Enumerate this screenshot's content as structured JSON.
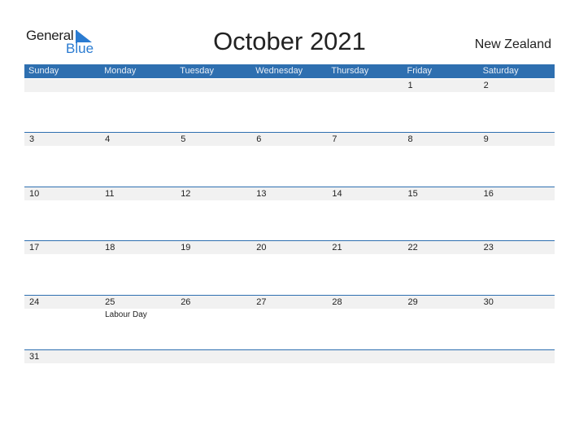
{
  "logo": {
    "line1": "General",
    "line2": "Blue"
  },
  "title": "October 2021",
  "country": "New Zealand",
  "colors": {
    "header_bg": "#2e6fb0",
    "logo_blue": "#2a7bd1",
    "date_strip": "#f1f1f1"
  },
  "weekdays": [
    "Sunday",
    "Monday",
    "Tuesday",
    "Wednesday",
    "Thursday",
    "Friday",
    "Saturday"
  ],
  "weeks": [
    [
      {
        "d": ""
      },
      {
        "d": ""
      },
      {
        "d": ""
      },
      {
        "d": ""
      },
      {
        "d": ""
      },
      {
        "d": "1"
      },
      {
        "d": "2"
      }
    ],
    [
      {
        "d": "3"
      },
      {
        "d": "4"
      },
      {
        "d": "5"
      },
      {
        "d": "6"
      },
      {
        "d": "7"
      },
      {
        "d": "8"
      },
      {
        "d": "9"
      }
    ],
    [
      {
        "d": "10"
      },
      {
        "d": "11"
      },
      {
        "d": "12"
      },
      {
        "d": "13"
      },
      {
        "d": "14"
      },
      {
        "d": "15"
      },
      {
        "d": "16"
      }
    ],
    [
      {
        "d": "17"
      },
      {
        "d": "18"
      },
      {
        "d": "19"
      },
      {
        "d": "20"
      },
      {
        "d": "21"
      },
      {
        "d": "22"
      },
      {
        "d": "23"
      }
    ],
    [
      {
        "d": "24"
      },
      {
        "d": "25",
        "event": "Labour Day"
      },
      {
        "d": "26"
      },
      {
        "d": "27"
      },
      {
        "d": "28"
      },
      {
        "d": "29"
      },
      {
        "d": "30"
      }
    ],
    [
      {
        "d": "31"
      },
      {
        "d": ""
      },
      {
        "d": ""
      },
      {
        "d": ""
      },
      {
        "d": ""
      },
      {
        "d": ""
      },
      {
        "d": ""
      }
    ]
  ]
}
